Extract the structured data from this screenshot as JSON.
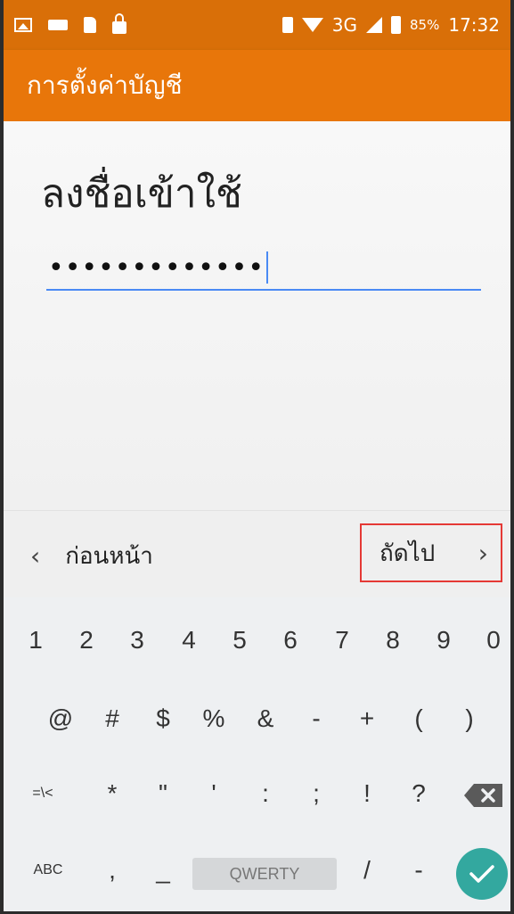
{
  "status_bar": {
    "battery_percent": "85%",
    "network": "3G",
    "time": "17:32",
    "icons": [
      "image-icon",
      "keyboard-icon",
      "sim-icon",
      "lock-icon",
      "vibrate-icon",
      "wifi-icon",
      "signal-icon",
      "battery-icon"
    ]
  },
  "app_bar": {
    "title": "การตั้งค่าบัญชี"
  },
  "main": {
    "heading": "ลงชื่อเข้าใช้",
    "password": {
      "value": "•••••••••••••",
      "type": "password"
    }
  },
  "nav": {
    "back_chevron": "‹",
    "back_label": "ก่อนหน้า",
    "next_label": "ถัดไป",
    "next_chevron": "›",
    "highlight_color": "#e53935"
  },
  "keyboard": {
    "row1": [
      "1",
      "2",
      "3",
      "4",
      "5",
      "6",
      "7",
      "8",
      "9",
      "0"
    ],
    "row2": [
      "@",
      "#",
      "$",
      "%",
      "&",
      "-",
      "+",
      "(",
      ")"
    ],
    "row3": [
      "=\\<",
      "*",
      "\"",
      "'",
      ":",
      ";",
      "!",
      "?"
    ],
    "row4": [
      "ABC",
      ",",
      "_"
    ],
    "space_label": "QWERTY",
    "row4_after": [
      "/",
      "-"
    ],
    "enter_color": "#33a89f",
    "backspace_icon": "backspace-icon",
    "enter_icon": "check-icon"
  },
  "colors": {
    "status_bar": "#d96f08",
    "app_bar": "#e8760a",
    "input_underline": "#4a8af4"
  }
}
